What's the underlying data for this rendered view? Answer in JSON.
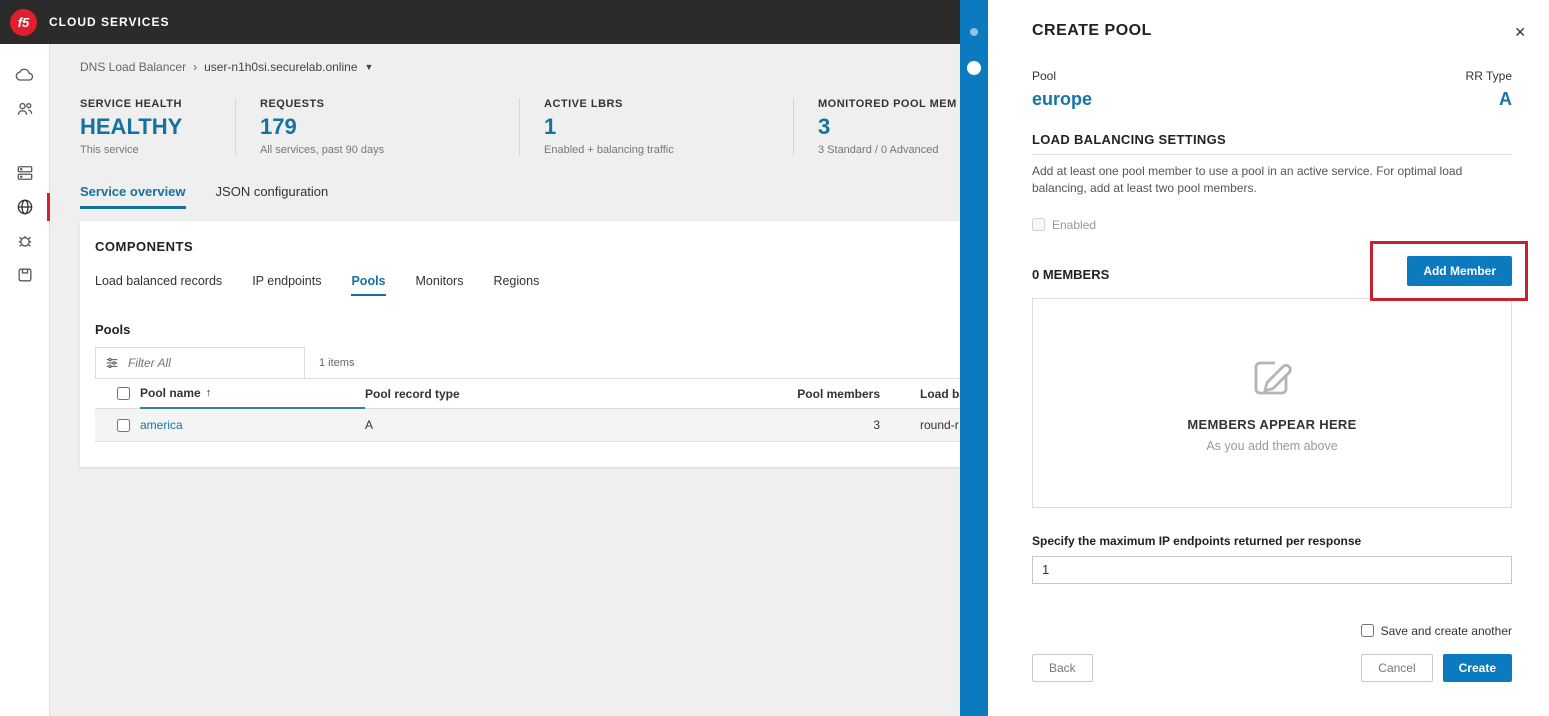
{
  "colors": {
    "accent": "#0c7abf",
    "link": "#1474a6",
    "value_blue": "#15719f",
    "annotation_red": "#c2232c",
    "brand_red": "#e21d2c"
  },
  "header": {
    "logo": "f5",
    "brand": "CLOUD SERVICES"
  },
  "sidebar": {
    "items": [
      {
        "icon": "cloud-icon"
      },
      {
        "icon": "users-icon"
      },
      {
        "icon": "server-icon"
      },
      {
        "icon": "globe-icon",
        "active": true
      },
      {
        "icon": "bug-icon"
      },
      {
        "icon": "archive-icon"
      }
    ]
  },
  "main": {
    "breadcrumb": {
      "root": "DNS Load Balancer",
      "separator": "›",
      "current": "user-n1h0si.securelab.online"
    },
    "stats": [
      {
        "label": "SERVICE HEALTH",
        "value": "HEALTHY",
        "sub": "This service"
      },
      {
        "label": "REQUESTS",
        "value": "179",
        "sub": "All services, past 90 days"
      },
      {
        "label": "ACTIVE LBRS",
        "value": "1",
        "sub": "Enabled + balancing traffic"
      },
      {
        "label": "MONITORED POOL MEM",
        "value": "3",
        "sub": "3 Standard / 0 Advanced"
      }
    ],
    "tabs": [
      {
        "label": "Service overview",
        "active": true
      },
      {
        "label": "JSON configuration",
        "active": false
      }
    ],
    "components": {
      "title": "COMPONENTS",
      "tabs": [
        {
          "label": "Load balanced records",
          "active": false
        },
        {
          "label": "IP endpoints",
          "active": false
        },
        {
          "label": "Pools",
          "active": true
        },
        {
          "label": "Monitors",
          "active": false
        },
        {
          "label": "Regions",
          "active": false
        }
      ],
      "section_title": "Pools",
      "filter_placeholder": "Filter All",
      "items_count": "1 items",
      "table": {
        "headers": {
          "name": "Pool name",
          "sort": "↑",
          "type": "Pool record type",
          "members": "Pool members",
          "lb": "Load ba"
        },
        "rows": [
          {
            "name": "america",
            "type": "A",
            "members": "3",
            "lb": "round-r"
          }
        ]
      }
    }
  },
  "panel": {
    "title": "CREATE POOL",
    "close_icon": "✕",
    "pool_label": "Pool",
    "pool_value": "europe",
    "rr_label": "RR Type",
    "rr_value": "A",
    "section_title": "LOAD BALANCING SETTINGS",
    "description": "Add at least one pool member to use a pool in an active service. For optimal load balancing, add at least two pool members.",
    "enabled_label": "Enabled",
    "members_count": "0 MEMBERS",
    "add_member_label": "Add Member",
    "empty_title": "MEMBERS APPEAR HERE",
    "empty_sub": "As you add them above",
    "max_ip_label": "Specify the maximum IP endpoints returned per response",
    "max_ip_value": "1",
    "save_another_label": "Save and create another",
    "back_label": "Back",
    "cancel_label": "Cancel",
    "create_label": "Create"
  }
}
